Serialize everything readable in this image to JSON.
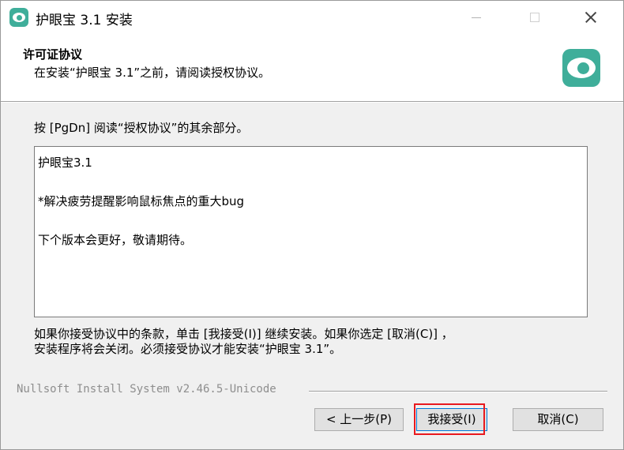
{
  "window": {
    "title": "护眼宝 3.1 安装"
  },
  "header": {
    "title": "许可证协议",
    "subtitle": "在安装“护眼宝 3.1”之前，请阅读授权协议。"
  },
  "instruction": "按 [PgDn] 阅读“授权协议”的其余部分。",
  "license": {
    "lines": [
      "护眼宝3.1",
      "*解决疲劳提醒影响鼠标焦点的重大bug",
      "下个版本会更好，敬请期待。"
    ]
  },
  "footer": {
    "line1": "如果你接受协议中的条款，单击 [我接受(I)] 继续安装。如果你选定 [取消(C)] ，",
    "line2": "安装程序将会关闭。必须接受协议才能安装“护眼宝 3.1”。"
  },
  "branding": "Nullsoft Install System v2.46.5-Unicode",
  "buttons": {
    "back": "< 上一步(P)",
    "accept": "我接受(I)",
    "cancel": "取消(C)"
  },
  "colors": {
    "brand": "#3fae9a",
    "highlight": "#e8191e",
    "default_button_border": "#0078d7"
  },
  "icons": {
    "app": "eye-icon",
    "header_logo": "eye-logo-icon"
  }
}
